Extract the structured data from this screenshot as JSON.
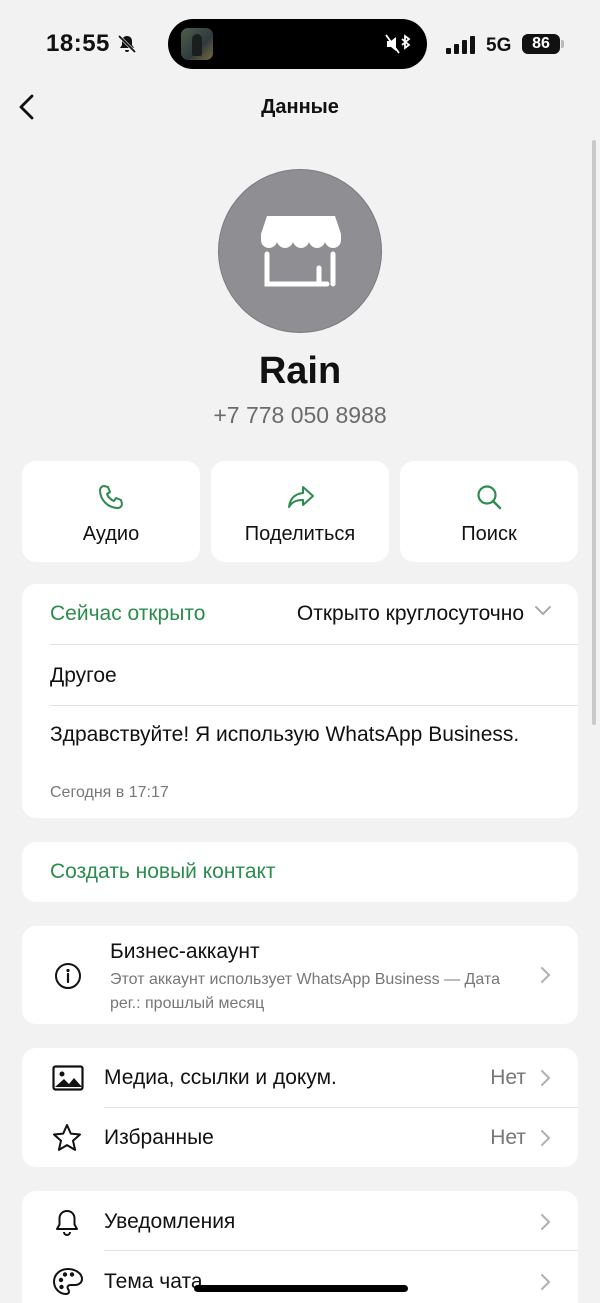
{
  "status_bar": {
    "time": "18:55",
    "network": "5G",
    "battery": "86"
  },
  "nav": {
    "title": "Данные"
  },
  "profile": {
    "name": "Rain",
    "phone": "+7 778 050 8988"
  },
  "actions": [
    {
      "label": "Аудио",
      "icon": "phone-icon"
    },
    {
      "label": "Поделиться",
      "icon": "share-arrow-icon"
    },
    {
      "label": "Поиск",
      "icon": "search-icon"
    }
  ],
  "business_hours": {
    "status": "Сейчас открыто",
    "hours": "Открыто круглосуточно"
  },
  "category": "Другое",
  "about": {
    "text": "Здравствуйте! Я использую WhatsApp Business.",
    "date": "Сегодня в 17:17"
  },
  "create_contact": "Создать новый контакт",
  "business_account": {
    "title": "Бизнес-аккаунт",
    "subtitle": "Этот аккаунт использует WhatsApp Business — Дата рег.: прошлый месяц"
  },
  "media_section": [
    {
      "label": "Медиа, ссылки и докум.",
      "value": "Нет",
      "icon": "image-icon"
    },
    {
      "label": "Избранные",
      "value": "Нет",
      "icon": "star-icon"
    }
  ],
  "settings_section": [
    {
      "label": "Уведомления",
      "icon": "bell-icon"
    },
    {
      "label": "Тема чата",
      "icon": "palette-icon"
    }
  ],
  "colors": {
    "accent": "#2e8b4f",
    "background": "#f2f2f2",
    "card": "#ffffff",
    "avatar": "#8e8e93"
  }
}
